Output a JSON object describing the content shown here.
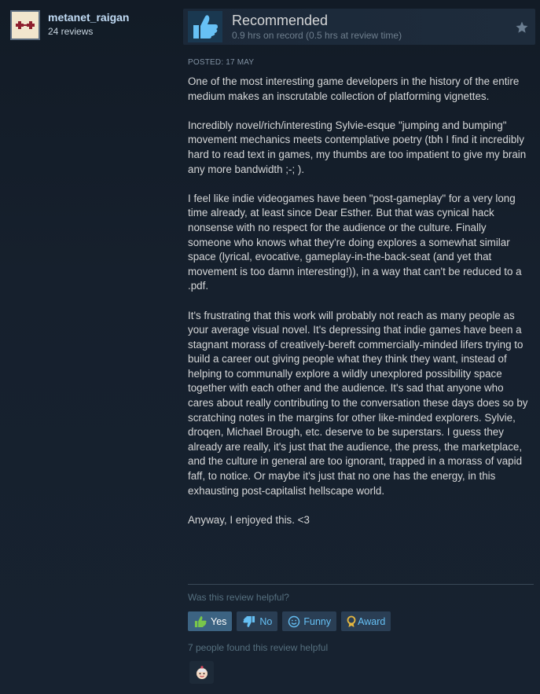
{
  "author": {
    "name": "metanet_raigan",
    "reviews": "24 reviews"
  },
  "header": {
    "title": "Recommended",
    "hours": "0.9 hrs on record (0.5 hrs at review time)",
    "icon": "thumbs-up-icon",
    "star_icon": "star-icon"
  },
  "review": {
    "posted": "POSTED: 17 MAY",
    "paragraphs": [
      "One of the most interesting game developers in the history of the entire medium makes an inscrutable collection of platforming vignettes.",
      "Incredibly novel/rich/interesting Sylvie-esque \"jumping and bumping\" movement mechanics meets contemplative poetry (tbh I find it incredibly hard to read text in games, my thumbs are too impatient to give my brain any more bandwidth ;-; ).",
      "I feel like indie videogames have been \"post-gameplay\" for a very long time already, at least since Dear Esther. But that was cynical hack nonsense with no respect for the audience or the culture. Finally someone who knows what they're doing explores a somewhat similar space (lyrical, evocative, gameplay-in-the-back-seat (and yet that movement is too damn interesting!)), in a way that can't be reduced to a .pdf.",
      "It's frustrating that this work will probably not reach as many people as your average visual novel. It's depressing that indie games have been a stagnant morass of creatively-bereft commercially-minded lifers trying to build a career out giving people what they think they want, instead of helping to communally explore a wildly unexplored possibility space together with each other and the audience. It's sad that anyone who cares about really contributing to the conversation these days does so by scratching notes in the margins for other like-minded explorers. Sylvie, droqen, Michael Brough, etc. deserve to be superstars. I guess they already are really, it's just that the audience, the press, the marketplace, and the culture in general are too ignorant, trapped in a morass of vapid faff, to notice. Or maybe it's just that no one has the energy, in this exhausting post-capitalist hellscape world.",
      "Anyway, I enjoyed this. <3"
    ]
  },
  "feedback": {
    "question": "Was this review helpful?",
    "buttons": {
      "yes": "Yes",
      "no": "No",
      "funny": "Funny",
      "award": "Award"
    },
    "found_helpful": "7 people found this review helpful",
    "award_icon": "award-emoji-icon"
  },
  "colors": {
    "background": "#16202d",
    "accent": "#66c0f4",
    "selected_button": "#3c6382",
    "author_name": "#c1dbf4"
  }
}
